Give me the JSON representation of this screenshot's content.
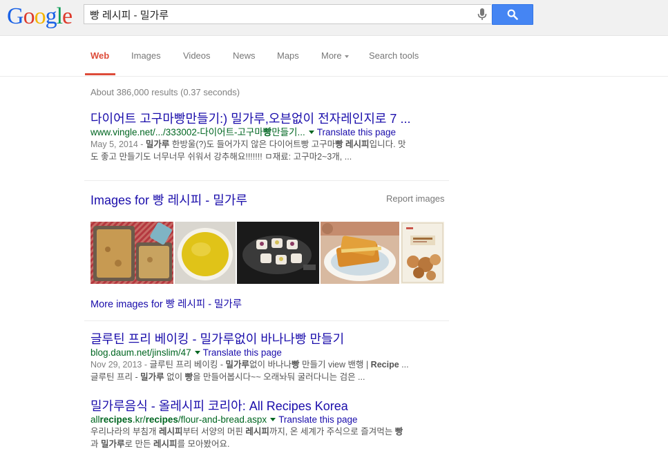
{
  "logo": [
    "G",
    "o",
    "o",
    "g",
    "l",
    "e"
  ],
  "search": {
    "query": "빵 레시피 - 밀가루"
  },
  "tabs": [
    {
      "label": "Web",
      "active": true
    },
    {
      "label": "Images"
    },
    {
      "label": "Videos"
    },
    {
      "label": "News"
    },
    {
      "label": "Maps"
    },
    {
      "label": "More"
    },
    {
      "label": "Search tools"
    }
  ],
  "stats": "About 386,000 results (0.37 seconds)",
  "results": [
    {
      "title": "다이어트 고구마빵만들기:) 밀가루,오븐없이 전자레인지로 7 ...",
      "url_pre": "www.vingle.net/.../333002-다이어트-고구마",
      "url_bold": "빵",
      "url_post": "만들기...",
      "translate": "Translate this page",
      "snippet_date": "May 5, 2014 - ",
      "snippet_line1_parts": [
        "밀가루",
        " 한방울(?)도 들어가지 않은 다이어트빵 고구마",
        "빵 레시피",
        "입니다. 맛"
      ],
      "snippet_line2": "도 좋고 만들기도 너무너무 쉬워서 강추해요!!!!!!! ㅁ재료: 고구마2~3개, ..."
    },
    {
      "title": "글루틴 프리 베이킹 - 밀가루없이 바나나빵 만들기",
      "url": "blog.daum.net/jinslim/47",
      "translate": "Translate this page",
      "snippet_date": "Nov 29, 2013 - ",
      "snippet_line1_parts": [
        "글루틴 프리 베이킹 - ",
        "밀가루",
        "없이 바나나",
        "빵",
        " 만들기 view 밴행 | ",
        "Recipe",
        " ..."
      ],
      "snippet_line2_parts": [
        "글루틴 프리 - ",
        "밀가루",
        " 없이 ",
        "빵",
        "을 만들어봅시다~~ 오래놔둬 굴러다니는 검은 ..."
      ]
    },
    {
      "title": "밀가루음식 - 올레시피 코리아: All Recipes Korea",
      "url_parts": [
        "all",
        "recipes",
        ".kr/",
        "recipes",
        "/flour-and-bread.aspx"
      ],
      "translate": "Translate this page",
      "snippet_line1_parts": [
        "우리나라의 부침개 ",
        "레시피",
        "부터 서양의 머핀 ",
        "레시피",
        "까지, 온 세계가 주식으로 즐겨먹는 ",
        "빵"
      ],
      "snippet_line2_parts": [
        "과 ",
        "밀가루",
        "로 만든 ",
        "레시피",
        "를 모아봤어요."
      ]
    }
  ],
  "images_block": {
    "heading": "Images for 빵 레시피 - 밀가루",
    "report": "Report images",
    "more": "More images for 빵 레시피 - 밀가루"
  },
  "colors": {
    "accent": "#dd4b39",
    "link": "#1a0dab",
    "url": "#006621",
    "search_button": "#4585f3"
  }
}
